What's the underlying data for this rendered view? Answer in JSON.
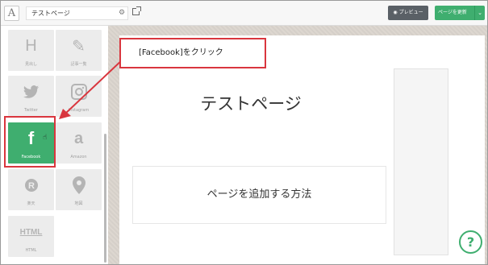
{
  "app": {
    "logo_letter": "A"
  },
  "header": {
    "title_value": "テストページ",
    "preview_label": "プレビュー",
    "update_label": "ページを更新"
  },
  "sidebar": {
    "tiles": [
      {
        "label": "見出し",
        "icon": "heading-icon",
        "glyph": "H"
      },
      {
        "label": "記事一覧",
        "icon": "edit-icon",
        "glyph": "✎"
      },
      {
        "label": "Twitter",
        "icon": "twitter-icon",
        "glyph": "🐦"
      },
      {
        "label": "Instagram",
        "icon": "instagram-icon",
        "glyph": "◎"
      },
      {
        "label": "Facebook",
        "icon": "facebook-icon",
        "glyph": "f"
      },
      {
        "label": "Amazon",
        "icon": "amazon-icon",
        "glyph": "a"
      },
      {
        "label": "楽天",
        "icon": "rakuten-icon",
        "glyph": "R"
      },
      {
        "label": "地図",
        "icon": "map-pin-icon",
        "glyph": "⬤"
      },
      {
        "label": "HTML",
        "icon": "html-icon",
        "glyph": "HTML"
      }
    ]
  },
  "canvas": {
    "page_heading": "テストページ",
    "content_text": "ページを追加する方法"
  },
  "annotation": {
    "callout_text": "[Facebook]をクリック"
  },
  "help": {
    "label": "?"
  },
  "colors": {
    "accent_green": "#3fae6f",
    "annotation_red": "#d9363e",
    "preview_gray": "#5a6066"
  }
}
